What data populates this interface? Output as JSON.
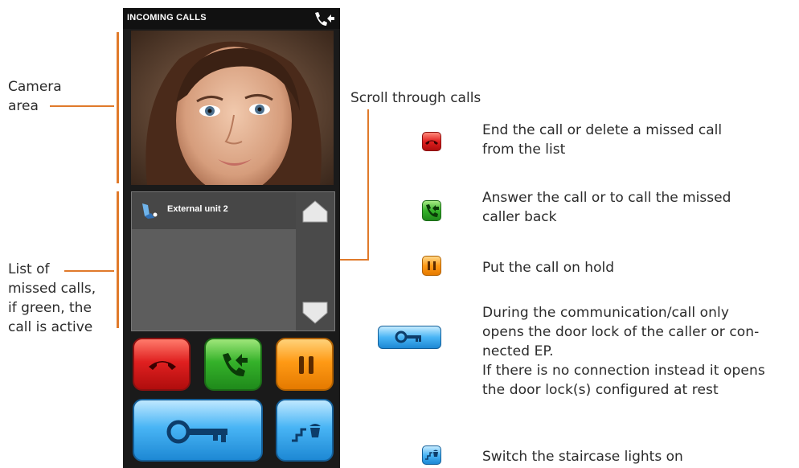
{
  "annotations": {
    "camera_area_line1": "Camera",
    "camera_area_line2": "area",
    "missed_calls_lines": [
      "List of",
      "missed calls,",
      "if green, the",
      "call is active"
    ],
    "scroll_label": "Scroll through calls"
  },
  "device": {
    "status_title": "INCOMING CALLS",
    "status_icon": "phone-incoming-icon",
    "list": {
      "rows": [
        {
          "icon": "external-unit-icon",
          "label": "External unit 2"
        }
      ],
      "scroll_up_icon": "arrow-up-icon",
      "scroll_down_icon": "arrow-down-icon"
    },
    "buttons": {
      "end_call": "end-call-icon",
      "answer": "answer-call-icon",
      "hold": "pause-icon",
      "door_lock": "key-icon",
      "stairs_light": "staircase-light-icon"
    }
  },
  "legend": {
    "end_call": [
      "End the call or delete a missed call",
      "from the list"
    ],
    "answer": [
      "Answer the call or to call the missed",
      "caller back"
    ],
    "hold": [
      "Put the call on hold"
    ],
    "door_lock": [
      "During the communication/call only",
      "opens the door lock of the caller or con-",
      "nected EP.",
      "If there is no connection instead it opens",
      "the door lock(s) configured at rest"
    ],
    "stairs": [
      "Switch the staircase lights on"
    ]
  },
  "colors": {
    "accent_line": "#e07a2b",
    "red": "#e02020",
    "green": "#35b22a",
    "orange": "#ff9a15",
    "blue": "#49b5f5"
  }
}
